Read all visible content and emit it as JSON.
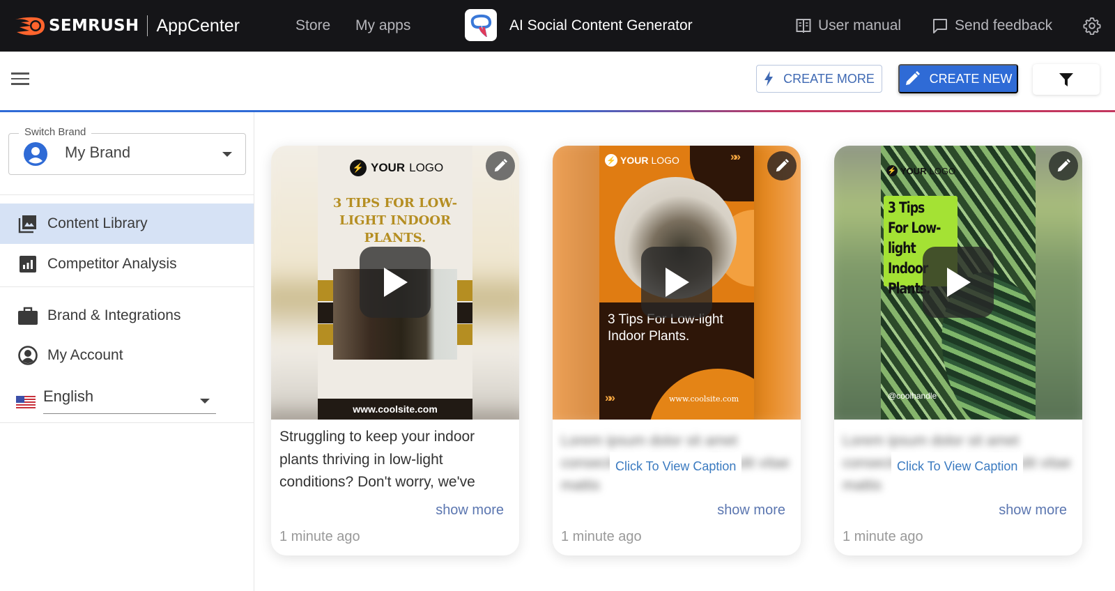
{
  "topbar": {
    "brand_name": "SEMRUSH",
    "brand_app": "AppCenter",
    "nav": [
      {
        "label": "Store"
      },
      {
        "label": "My apps"
      }
    ],
    "app_title": "AI Social Content Generator",
    "user_manual": "User manual",
    "send_feedback": "Send feedback",
    "settings_icon": "gear-icon"
  },
  "toolbar": {
    "menu_icon": "hamburger-icon",
    "create_more_label": "CREATE MORE",
    "create_new_label": "CREATE NEW",
    "filter_icon": "filter-icon",
    "colors": {
      "primary": "#2f6bd6",
      "accent": "#c2365e"
    }
  },
  "sidebar": {
    "switch_brand_label": "Switch Brand",
    "brand_value": "My Brand",
    "items": [
      {
        "label": "Content Library",
        "icon": "image-library-icon",
        "active": true
      },
      {
        "label": "Competitor Analysis",
        "icon": "bar-chart-icon",
        "active": false
      },
      {
        "label": "Brand & Integrations",
        "icon": "briefcase-icon",
        "active": false
      },
      {
        "label": "My Account",
        "icon": "account-circle-icon",
        "active": false
      }
    ],
    "language": "English"
  },
  "cards": [
    {
      "poster": {
        "logo_bold": "YOUR",
        "logo_light": "LOGO",
        "title": "3 TIPS FOR LOW-LIGHT INDOOR PLANTS.",
        "footer": "www.coolsite.com"
      },
      "caption": "Struggling to keep your indoor plants thriving in low-light conditions? Don't worry, we've",
      "show_more": "show more",
      "time": "1 minute ago"
    },
    {
      "poster": {
        "logo_bold": "YOUR",
        "logo_light": "LOGO",
        "title": "3 Tips For Low-light Indoor Plants.",
        "footer": "www.coolsite.com",
        "chevrons": "»»"
      },
      "caption_blurred": "Lorem ipsum dolor sit amet consectetur adipiscing Blandit vitae mattis",
      "view_caption": "Click To View Caption",
      "show_more": "show more",
      "time": "1 minute ago"
    },
    {
      "poster": {
        "logo_bold": "YOUR",
        "logo_light": "LOGO",
        "title": "3 Tips For Low-light Indoor Plants.",
        "handle": "@coolhandle"
      },
      "caption_blurred": "Lorem ipsum dolor sit amet consectetur adipiscing Blandit vitae mattis",
      "view_caption": "Click To View Caption",
      "show_more": "show more",
      "time": "1 minute ago"
    }
  ]
}
